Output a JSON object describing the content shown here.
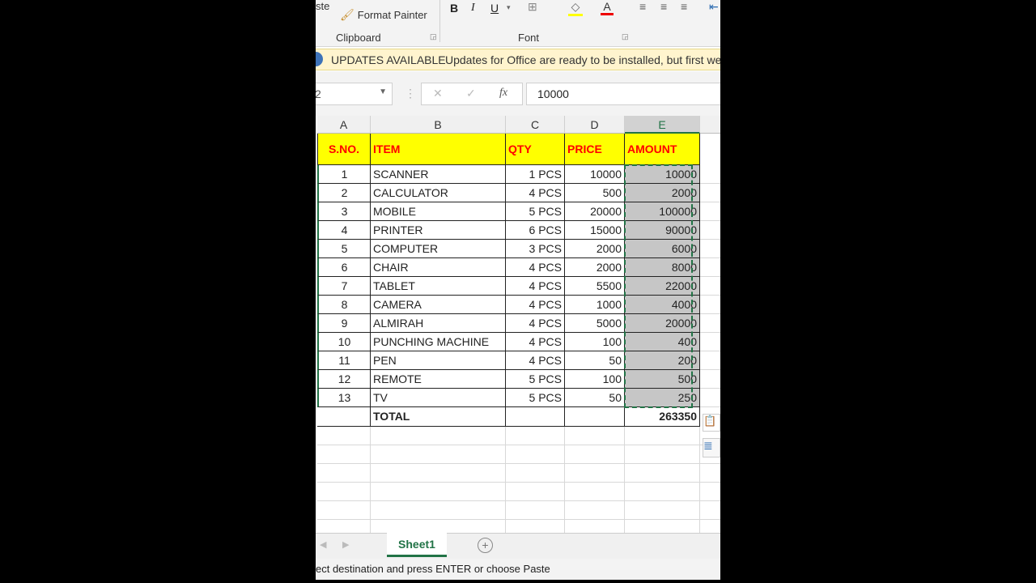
{
  "ribbon": {
    "paste_label": "ste",
    "format_painter": "Format Painter",
    "clipboard_group": "Clipboard",
    "font_group": "Font",
    "bold": "B",
    "italic": "I",
    "underline": "U"
  },
  "updates": {
    "title": "UPDATES AVAILABLE",
    "message": "Updates for Office are ready to be installed, but first we n"
  },
  "formula_bar": {
    "name_box": "2",
    "fx": "fx",
    "value": "10000"
  },
  "columns": [
    "A",
    "B",
    "C",
    "D",
    "E"
  ],
  "selected_column": "E",
  "header": [
    "S.NO.",
    "ITEM",
    "QTY",
    "PRICE",
    "AMOUNT"
  ],
  "rows": [
    [
      "1",
      "SCANNER",
      "1 PCS",
      "10000",
      "10000"
    ],
    [
      "2",
      "CALCULATOR",
      "4 PCS",
      "500",
      "2000"
    ],
    [
      "3",
      "MOBILE",
      "5 PCS",
      "20000",
      "100000"
    ],
    [
      "4",
      "PRINTER",
      "6 PCS",
      "15000",
      "90000"
    ],
    [
      "5",
      "COMPUTER",
      "3 PCS",
      "2000",
      "6000"
    ],
    [
      "6",
      "CHAIR",
      "4 PCS",
      "2000",
      "8000"
    ],
    [
      "7",
      "TABLET",
      "4 PCS",
      "5500",
      "22000"
    ],
    [
      "8",
      "CAMERA",
      "4 PCS",
      "1000",
      "4000"
    ],
    [
      "9",
      "ALMIRAH",
      "4 PCS",
      "5000",
      "20000"
    ],
    [
      "10",
      "PUNCHING MACHINE",
      "4 PCS",
      "100",
      "400"
    ],
    [
      "11",
      "PEN",
      "4 PCS",
      "50",
      "200"
    ],
    [
      "12",
      "REMOTE",
      "5 PCS",
      "100",
      "500"
    ],
    [
      "13",
      "TV",
      "5 PCS",
      "50",
      "250"
    ]
  ],
  "total": {
    "label": "TOTAL",
    "value": "263350"
  },
  "sheet_tab": "Sheet1",
  "status": "ect destination and press ENTER or choose Paste",
  "colors": {
    "header_fill": "#ffff00",
    "header_text": "#ff0000",
    "accent": "#217346"
  }
}
